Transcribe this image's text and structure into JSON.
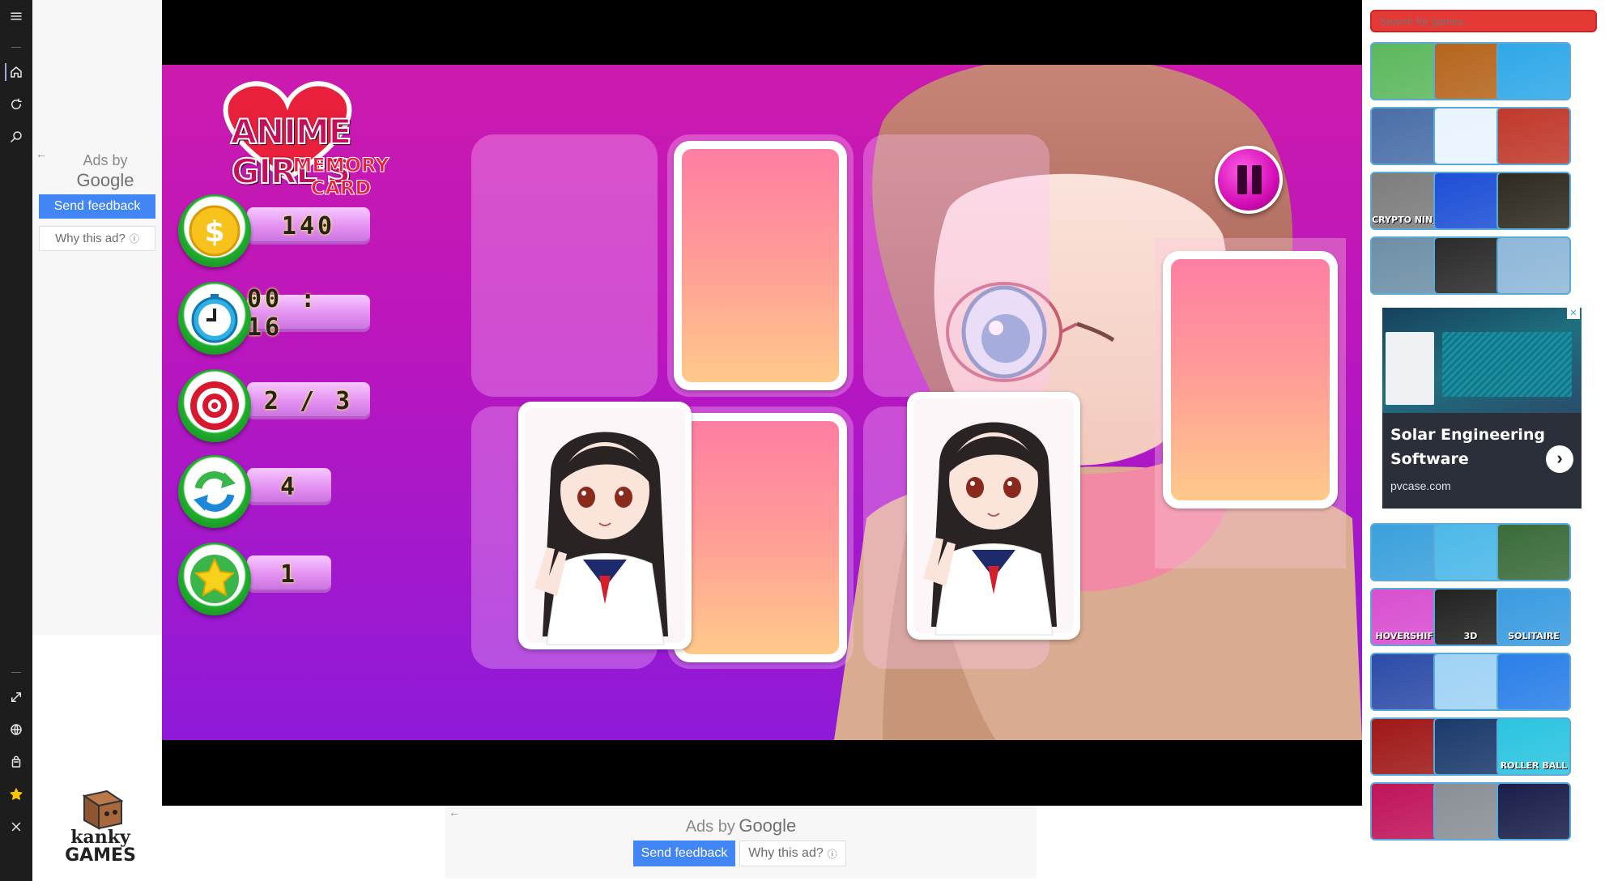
{
  "left_ad": {
    "ads_by": "Ads by",
    "google": "Google",
    "send_feedback": "Send feedback",
    "why_this_ad": "Why this ad?"
  },
  "bottom_ad": {
    "ads_by": "Ads by",
    "google": "Google",
    "send_feedback": "Send feedback",
    "why_this_ad": "Why this ad?"
  },
  "logo": {
    "line1": "kanky",
    "line2": "GAMES"
  },
  "game": {
    "title_line1": "ANIME GIRL'S",
    "title_line2": "MEMORY CARD",
    "coins": "140",
    "timer": "00 : 16",
    "target": "2 / 3",
    "moves": "4",
    "stars": "1"
  },
  "search": {
    "placeholder": "Search for games.."
  },
  "sidebar_ad": {
    "headline_line1": "Solar Engineering",
    "headline_line2": "Software",
    "domain": "pvcase.com"
  },
  "thumbs_top": [
    {
      "name": "offroad-car",
      "label": "",
      "color": "#5cb85c"
    },
    {
      "name": "crash-dummy",
      "label": "",
      "color": "#b5651d"
    },
    {
      "name": "snake",
      "label": "",
      "color": "#2fa8e8"
    },
    {
      "name": "hitman",
      "label": "",
      "color": "#4a6ea8"
    },
    {
      "name": "color-race",
      "label": "",
      "color": "#e8f4ff"
    },
    {
      "name": "viking",
      "label": "",
      "color": "#c0392b"
    },
    {
      "name": "crypto-ninja",
      "label": "CRYPTO NINJA",
      "color": "#7d7d7d"
    },
    {
      "name": "syringe",
      "label": "",
      "color": "#1d4fd6"
    },
    {
      "name": "stickman-jump",
      "label": "",
      "color": "#2e2a1f"
    },
    {
      "name": "battle-cars",
      "label": "",
      "color": "#6d8fa6"
    },
    {
      "name": "skull-kart",
      "label": "",
      "color": "#2b2b2b"
    },
    {
      "name": "stickman-fight",
      "label": "",
      "color": "#8fb7d8"
    }
  ],
  "thumbs_bottom": [
    {
      "name": "pirate-ship",
      "label": "",
      "color": "#3aa0dc"
    },
    {
      "name": "sky-runner",
      "label": "",
      "color": "#4cb8e8"
    },
    {
      "name": "virus-arena",
      "label": "",
      "color": "#3a6b3a"
    },
    {
      "name": "hovershift",
      "label": "HOVERSHIFT",
      "color": "#d84fd0"
    },
    {
      "name": "tangram-3d",
      "label": "3D",
      "color": "#222"
    },
    {
      "name": "solitaire-farm",
      "label": "SOLITAIRE",
      "color": "#3a9be0"
    },
    {
      "name": "huggy",
      "label": "",
      "color": "#2d4ca8"
    },
    {
      "name": "acrobat",
      "label": "",
      "color": "#9fd2f5"
    },
    {
      "name": "red-crewmate",
      "label": "",
      "color": "#2a7fe8"
    },
    {
      "name": "mahjong-red",
      "label": "",
      "color": "#a01818"
    },
    {
      "name": "bubble-shooter",
      "label": "",
      "color": "#1b3a6b"
    },
    {
      "name": "roller-ball",
      "label": "ROLLER BALL",
      "color": "#2bc4e0"
    },
    {
      "name": "sports-car",
      "label": "",
      "color": "#c0145a"
    },
    {
      "name": "moto-road",
      "label": "",
      "color": "#8a8f96"
    },
    {
      "name": "block-puzzle",
      "label": "",
      "color": "#1a1f4a"
    }
  ],
  "colors": {
    "accent": "#4285f4",
    "search_red": "#e53935",
    "stage_magenta": "#cc1aae",
    "stage_purple": "#8e1ad9"
  }
}
